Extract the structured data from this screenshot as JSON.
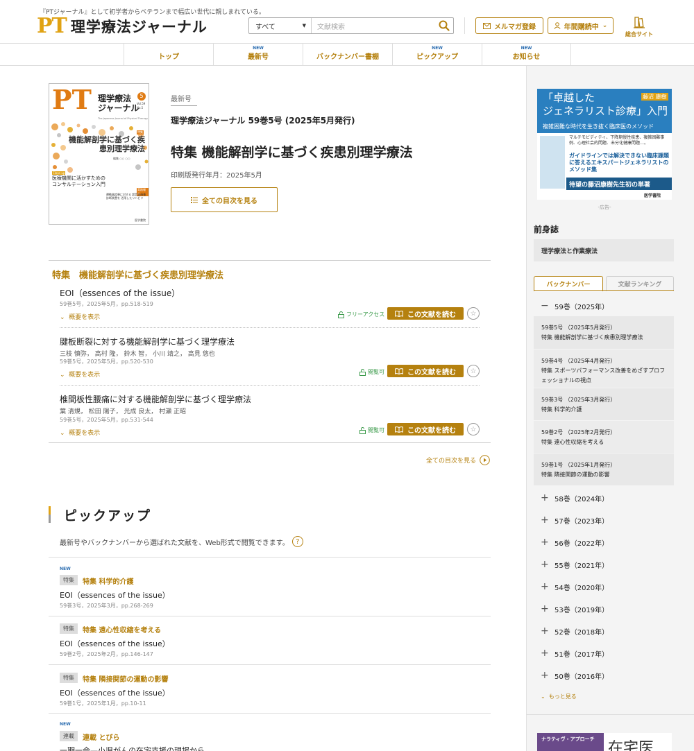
{
  "header": {
    "tagline": "『PTジャーナル』として初学者からベテランまで幅広い世代に親しまれている。",
    "logo_pt": "PT",
    "logo_text": "理学療法ジャーナル",
    "search_scope": "すべて",
    "search_placeholder": "文献検索",
    "newsletter_btn": "メルマガ登録",
    "subscription_btn": "年間購読中",
    "portal_label": "総合サイト"
  },
  "nav": [
    {
      "label": "トップ",
      "new": ""
    },
    {
      "label": "最新号",
      "new": "NEW"
    },
    {
      "label": "バックナンバー書棚",
      "new": ""
    },
    {
      "label": "ピックアップ",
      "new": "NEW"
    },
    {
      "label": "お知らせ",
      "new": "NEW"
    }
  ],
  "cover": {
    "logo": "PT",
    "title": "理学療法ジャーナル",
    "en_title": "The Japanese Journal of Physical Therapy",
    "number": "5",
    "year": "2025",
    "vol": "Vol.59",
    "no": "No.5",
    "feature_tag": "特集",
    "feature": "機能解剖学に基づく疾患別理学療法",
    "editor": "編集 ○○ ○○",
    "serial_title": "医療機関に活かすための コンサルテーション入門",
    "serial_tag": "Close-up",
    "report_tag": "実践報告",
    "report": "運動器疾患に対する 超音波画像診断装置を 活用したリハビリ",
    "publisher": "医学書院"
  },
  "latest": {
    "label": "最新号",
    "issue_name": "理学療法ジャーナル 59巻5号 (2025年5月発行)",
    "feature_title": "特集 機能解剖学に基づく疾患別理学療法",
    "print_date": "印刷版発行年月：2025年5月",
    "toc_button": "全ての目次を見る"
  },
  "feature_section": {
    "heading": "特集　機能解剖学に基づく疾患別理学療法",
    "articles": [
      {
        "title": "EOI（essences of the issue）",
        "authors": "",
        "meta": "59巻5号，2025年5月，pp.518-519",
        "abstract": "概要を表示",
        "access": "フリーアクセス",
        "read": "この文献を読む"
      },
      {
        "title": "腱板断裂に対する機能解剖学に基づく理学療法",
        "authors": "三枝 慎弥，  高村 隆，  鈴木 智，  小川 靖之，  高見 悠也",
        "meta": "59巻5号，2025年5月，pp.520-530",
        "abstract": "概要を表示",
        "access": "閲覧可",
        "read": "この文献を読む"
      },
      {
        "title": "椎間板性腰痛に対する機能解剖学に基づく理学療法",
        "authors": "葉 清規，  松田 陽子，  光成 良太，  村瀬 正昭",
        "meta": "59巻5号，2025年5月，pp.531-544",
        "abstract": "概要を表示",
        "access": "閲覧可",
        "read": "この文献を読む"
      }
    ],
    "all_toc": "全ての目次を見る"
  },
  "pickup": {
    "heading": "ピックアップ",
    "description": "最新号やバックナンバーから選ばれた文献を、Web形式で閲覧できます。",
    "help": "?",
    "items": [
      {
        "new": "NEW",
        "tag": "特集",
        "feature": "特集 科学的介護",
        "title": "EOI（essences of the issue）",
        "meta": "59巻3号，2025年3月，pp.268-269"
      },
      {
        "new": "",
        "tag": "特集",
        "feature": "特集 遠心性収縮を考える",
        "title": "EOI（essences of the issue）",
        "meta": "59巻2号，2025年2月，pp.146-147"
      },
      {
        "new": "",
        "tag": "特集",
        "feature": "特集 隣接関節の運動の影響",
        "title": "EOI（essences of the issue）",
        "meta": "59巻1号，2025年1月，pp.10-11"
      },
      {
        "new": "NEW",
        "tag": "連載",
        "feature": "連載 とびら",
        "title": "一期一会—小児がんの在宅支援の現場から",
        "meta": ""
      }
    ]
  },
  "sidebar": {
    "ad": {
      "title_line1": "「卓越した",
      "title_line2": "ジェネラリスト診療」入門",
      "author": "藤沼 康樹",
      "subtitle": "複雑困難な時代を生き抜く臨床医のメソッド",
      "desc": "マルチモビディティ、下降期慢性疾患、複雑困難事例、心理社会的問題、未分化健康問題…。",
      "highlight": "ガイドラインでは解決できない臨床課題に答えるエキスパートジェネラリストのメソッド集",
      "banner": "待望の藤沼康樹先生初の単著",
      "publisher": "医学書院",
      "caption": "-広告-"
    },
    "predecessor_heading": "前身誌",
    "predecessor": "理学療法と作業療法",
    "tab_backnumber": "バックナンバー",
    "tab_ranking": "文献ランキング",
    "open_volume": "59巻（2025年）",
    "issues": [
      {
        "line1": "59巻5号 （2025年5月発行）",
        "line2": "特集 機能解剖学に基づく疾患別理学療法"
      },
      {
        "line1": "59巻4号 （2025年4月発行）",
        "line2": "特集 スポーツパフォーマンス改善をめざすプロフェッショナルの視点"
      },
      {
        "line1": "59巻3号 （2025年3月発行）",
        "line2": "特集 科学的介護"
      },
      {
        "line1": "59巻2号 （2025年2月発行）",
        "line2": "特集 遠心性収縮を考える"
      },
      {
        "line1": "59巻1号 （2025年1月発行）",
        "line2": "特集 隣接関節の運動の影響"
      }
    ],
    "volumes": [
      "58巻（2024年）",
      "57巻（2023年）",
      "56巻（2022年）",
      "55巻（2021年）",
      "54巻（2020年）",
      "53巻（2019年）",
      "52巻（2018年）",
      "51巻（2017年）",
      "50巻（2016年）"
    ],
    "more": "もっと見る",
    "ad2_text": "ナラティヴ・アプローチ",
    "ad2_big": "在宅医"
  }
}
